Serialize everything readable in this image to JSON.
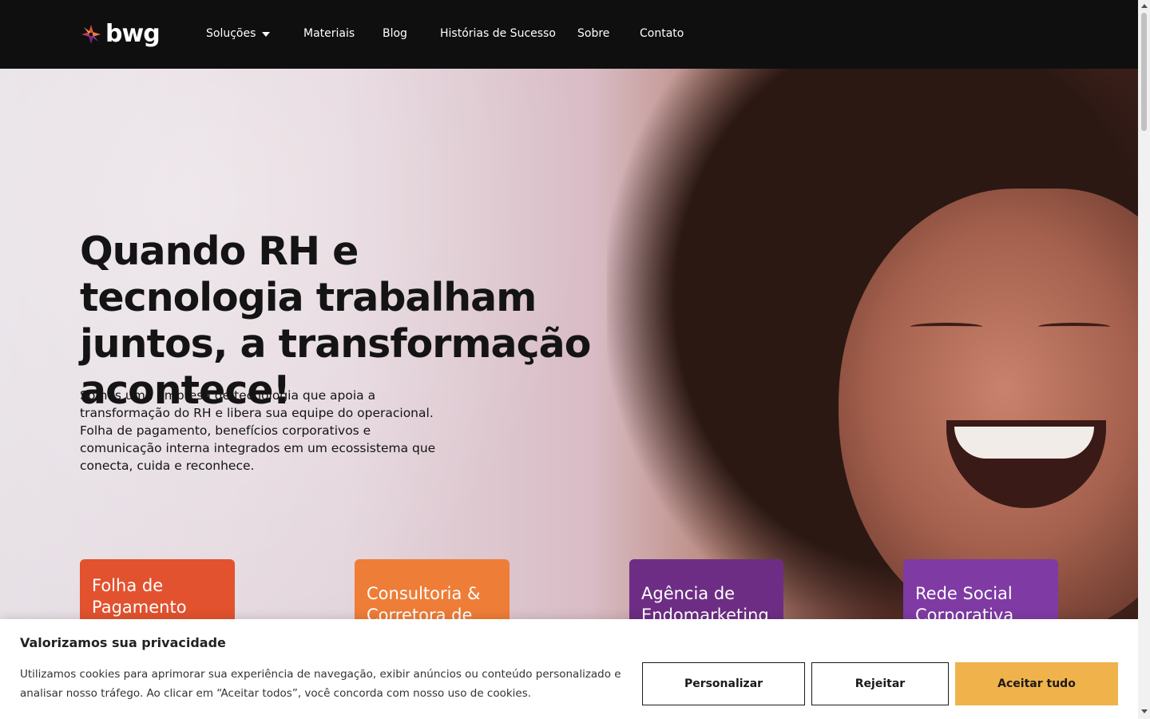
{
  "brand": {
    "logo_text": "bwg"
  },
  "nav": {
    "items": [
      {
        "label": "Soluções"
      },
      {
        "label": "Materiais"
      },
      {
        "label": "Blog"
      },
      {
        "label": "Histórias de Sucesso"
      },
      {
        "label": "Sobre"
      },
      {
        "label": "Contato"
      }
    ]
  },
  "hero": {
    "title": "Quando RH e tecnologia trabalham juntos, a transformação acontece!",
    "text": "Somos uma empresa de tecnologia que apoia a transformação do RH e libera sua equipe do operacional. Folha de pagamento, benefícios corporativos e comunicação interna integrados em um ecossistema que conecta, cuida e reconhece."
  },
  "cards": [
    {
      "label": "Folha de Pagamento",
      "color": "#e2522e"
    },
    {
      "label": "Consultoria & Corretora de",
      "color": "#ee7d37"
    },
    {
      "label": "Agência de Endomarketing",
      "color": "#6e2d84"
    },
    {
      "label": "Rede Social Corporativa",
      "color": "#7f3aa4"
    }
  ],
  "cookie_banner": {
    "title": "Valorizamos sua privacidade",
    "text": "Utilizamos cookies para aprimorar sua experiência de navegação, exibir anúncios ou conteúdo personalizado e analisar nosso tráfego. Ao clicar em “Aceitar todos”, você concorda com nosso uso de cookies.",
    "customize_label": "Personalizar",
    "reject_label": "Rejeitar",
    "accept_label": "Aceitar tudo",
    "accept_color": "#f0b24a"
  },
  "icons": {
    "logo": "bwg-spark-logo-icon",
    "dropdown": "caret-down-icon"
  }
}
